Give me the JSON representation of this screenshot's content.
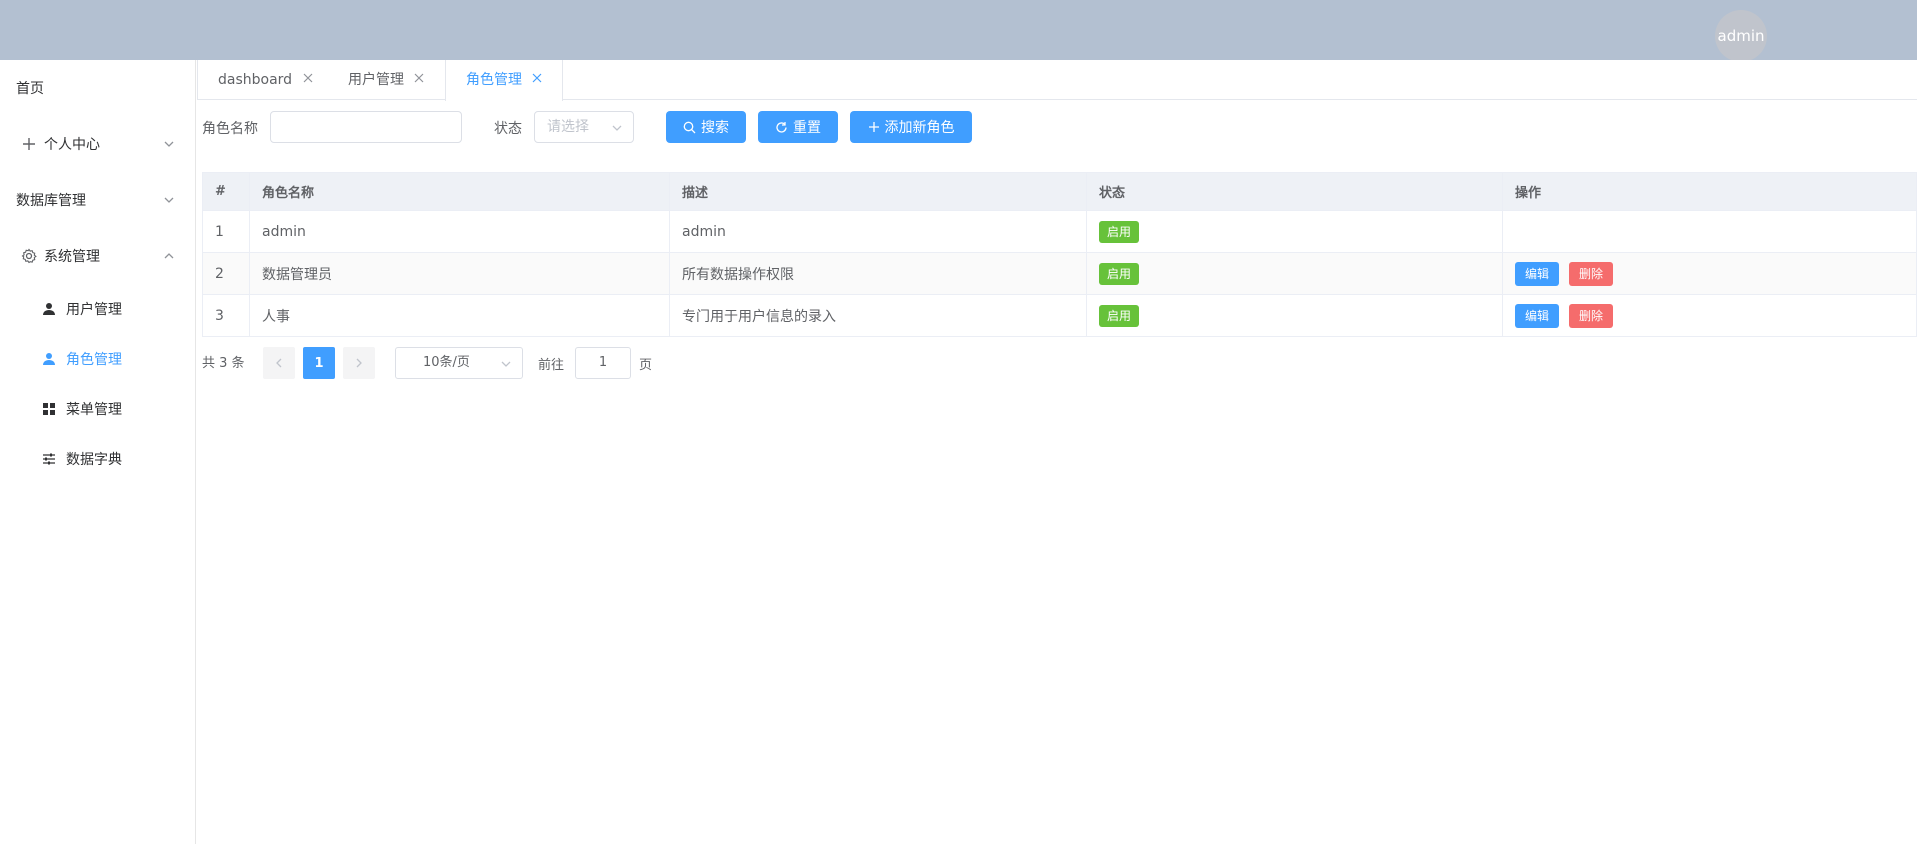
{
  "header": {
    "avatar_text": "admin"
  },
  "sidebar": {
    "home": "首页",
    "personal_center": "个人中心",
    "database_mgmt": "数据库管理",
    "system_mgmt": "系统管理",
    "sub_items": [
      {
        "label": "用户管理",
        "icon": "user-icon"
      },
      {
        "label": "角色管理",
        "icon": "user-icon",
        "active": true
      },
      {
        "label": "菜单管理",
        "icon": "grid-icon"
      },
      {
        "label": "数据字典",
        "icon": "sliders-icon"
      }
    ]
  },
  "tabs": [
    {
      "label": "dashboard"
    },
    {
      "label": "用户管理"
    },
    {
      "label": "角色管理",
      "active": true
    }
  ],
  "search": {
    "role_name_label": "角色名称",
    "role_name_value": "",
    "status_label": "状态",
    "status_placeholder": "请选择",
    "search_btn": "搜索",
    "reset_btn": "重置",
    "add_btn": "添加新角色"
  },
  "table": {
    "headers": [
      "#",
      "角色名称",
      "描述",
      "状态",
      "操作"
    ],
    "rows": [
      {
        "index": "1",
        "name": "admin",
        "desc": "admin",
        "status": "启用",
        "actions": false
      },
      {
        "index": "2",
        "name": "数据管理员",
        "desc": "所有数据操作权限",
        "status": "启用",
        "actions": true
      },
      {
        "index": "3",
        "name": "人事",
        "desc": "专门用于用户信息的录入",
        "status": "启用",
        "actions": true
      }
    ],
    "edit_label": "编辑",
    "delete_label": "删除"
  },
  "pagination": {
    "total_text": "共 3 条",
    "current_page": "1",
    "page_size": "10条/页",
    "goto_label": "前往",
    "goto_value": "1",
    "page_suffix": "页"
  },
  "colors": {
    "primary": "#409eff",
    "success": "#67c23a",
    "danger": "#f56c6c",
    "header_bg": "#b3c0d1"
  }
}
